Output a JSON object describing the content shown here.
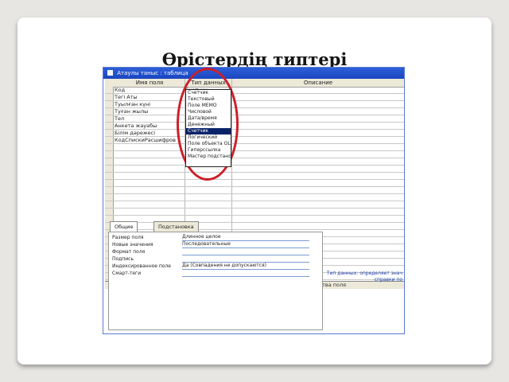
{
  "slide": {
    "title": "Өрістердің типтері"
  },
  "window": {
    "title": "Атаулы таныс : таблица"
  },
  "grid": {
    "headers": {
      "name": "Имя поля",
      "type": "Тип данных",
      "description": "Описание"
    },
    "rows": [
      {
        "name": "Код",
        "type": "Счетчик"
      },
      {
        "name": "Тегі Аты",
        "type": ""
      },
      {
        "name": "Туылған күні",
        "type": ""
      },
      {
        "name": "Туған жылы",
        "type": ""
      },
      {
        "name": "Тел",
        "type": ""
      },
      {
        "name": "Анкета жауабы",
        "type": ""
      },
      {
        "name": "Білім дәрежесі",
        "type": ""
      },
      {
        "name": "КодСпискиРасшифров",
        "type": ""
      }
    ]
  },
  "dropdown": {
    "items": [
      "Счетчик",
      "Текстовый",
      "Поле MEMO",
      "Числовой",
      "Дата/время",
      "Денежный",
      "Счетчик",
      "Логический",
      "Поле объекта OLE",
      "Гиперссылка",
      "Мастер подстано"
    ],
    "selected_index": 6
  },
  "properties": {
    "bar_label": "Свойства поля",
    "tabs": [
      "Общие",
      "Подстановка"
    ],
    "active_tab": 0,
    "rows": [
      {
        "label": "Размер поля",
        "value": "Длинное целое"
      },
      {
        "label": "Новые значения",
        "value": "Последовательные"
      },
      {
        "label": "Формат поля",
        "value": ""
      },
      {
        "label": "Подпись",
        "value": ""
      },
      {
        "label": "Индексированное поле",
        "value": "Да (Совпадения не допускаются)"
      },
      {
        "label": "Смарт-теги",
        "value": ""
      }
    ],
    "help_lines": [
      "Тип данных: определяет знач",
      "справки по"
    ]
  },
  "colors": {
    "titlebar": "#1a46c0",
    "highlight": "#cc1f2a",
    "selection": "#0a246a"
  }
}
